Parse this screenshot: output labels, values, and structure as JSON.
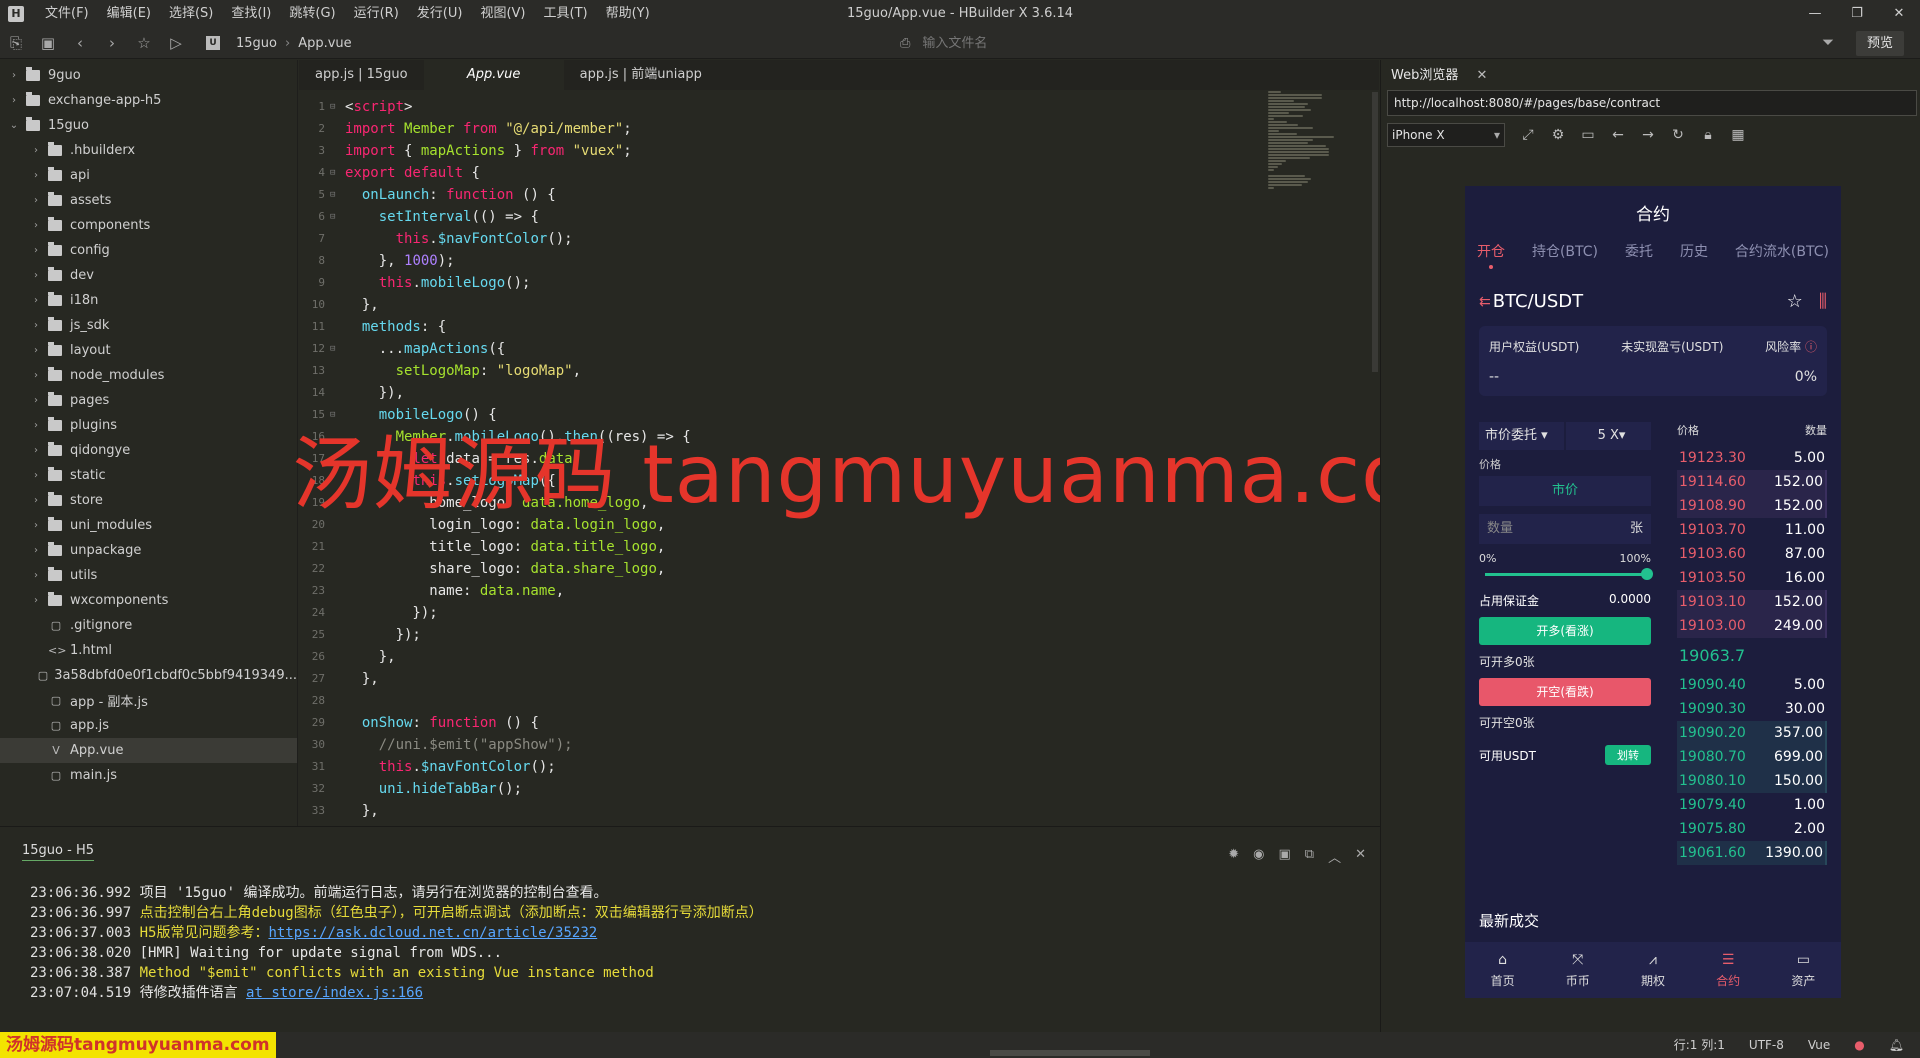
{
  "window": {
    "title": "15guo/App.vue - HBuilder X 3.6.14",
    "logo": "H",
    "menus": [
      "文件(F)",
      "编辑(E)",
      "选择(S)",
      "查找(I)",
      "跳转(G)",
      "运行(R)",
      "发行(U)",
      "视图(V)",
      "工具(T)",
      "帮助(Y)"
    ]
  },
  "toolbar": {
    "breadcrumb": [
      "15guo",
      "App.vue"
    ],
    "file_search_placeholder": "输入文件名",
    "preview_label": "预览"
  },
  "sidebar": {
    "items": [
      {
        "label": "9guo",
        "type": "folder",
        "expanded": false,
        "level": 0
      },
      {
        "label": "exchange-app-h5",
        "type": "folder",
        "expanded": false,
        "level": 0
      },
      {
        "label": "15guo",
        "type": "folder",
        "expanded": true,
        "level": 0
      },
      {
        "label": ".hbuilderx",
        "type": "folder",
        "level": 1
      },
      {
        "label": "api",
        "type": "folder",
        "level": 1
      },
      {
        "label": "assets",
        "type": "folder",
        "level": 1
      },
      {
        "label": "components",
        "type": "folder",
        "level": 1
      },
      {
        "label": "config",
        "type": "folder",
        "level": 1
      },
      {
        "label": "dev",
        "type": "folder",
        "level": 1
      },
      {
        "label": "i18n",
        "type": "folder",
        "level": 1
      },
      {
        "label": "js_sdk",
        "type": "folder",
        "level": 1
      },
      {
        "label": "layout",
        "type": "folder",
        "level": 1
      },
      {
        "label": "node_modules",
        "type": "folder",
        "level": 1
      },
      {
        "label": "pages",
        "type": "folder",
        "level": 1
      },
      {
        "label": "plugins",
        "type": "folder",
        "level": 1
      },
      {
        "label": "qidongye",
        "type": "folder",
        "level": 1
      },
      {
        "label": "static",
        "type": "folder",
        "level": 1
      },
      {
        "label": "store",
        "type": "folder",
        "level": 1
      },
      {
        "label": "uni_modules",
        "type": "folder",
        "level": 1
      },
      {
        "label": "unpackage",
        "type": "folder",
        "level": 1
      },
      {
        "label": "utils",
        "type": "folder",
        "level": 1
      },
      {
        "label": "wxcomponents",
        "type": "folder",
        "level": 1
      },
      {
        "label": ".gitignore",
        "type": "file",
        "level": 1
      },
      {
        "label": "1.html",
        "type": "html",
        "level": 1
      },
      {
        "label": "3a58dbfd0e0f1cbdf0c5bbf9419349...",
        "type": "file",
        "level": 1
      },
      {
        "label": "app - 副本.js",
        "type": "file",
        "level": 1
      },
      {
        "label": "app.js",
        "type": "file",
        "level": 1
      },
      {
        "label": "App.vue",
        "type": "vue",
        "level": 1,
        "selected": true
      },
      {
        "label": "main.js",
        "type": "file",
        "level": 1
      }
    ]
  },
  "tabs": [
    {
      "label": "app.js | 15guo",
      "active": false
    },
    {
      "label": "App.vue",
      "active": true
    },
    {
      "label": "app.js | 前端uniapp",
      "active": false
    }
  ],
  "editor": {
    "lines": [
      [
        [
          "tx",
          "<"
        ],
        [
          "kw",
          "script"
        ],
        [
          "tx",
          ">"
        ]
      ],
      [
        [
          "kw",
          "import"
        ],
        [
          "tx",
          " "
        ],
        [
          "pr",
          "Member"
        ],
        [
          "tx",
          " "
        ],
        [
          "kw",
          "from"
        ],
        [
          "tx",
          " "
        ],
        [
          "str",
          "\"@/api/member\""
        ],
        [
          "tx",
          ";"
        ]
      ],
      [
        [
          "kw",
          "import"
        ],
        [
          "tx",
          " { "
        ],
        [
          "pr",
          "mapActions"
        ],
        [
          "tx",
          " } "
        ],
        [
          "kw",
          "from"
        ],
        [
          "tx",
          " "
        ],
        [
          "str",
          "\"vuex\""
        ],
        [
          "tx",
          ";"
        ]
      ],
      [
        [
          "kw",
          "export default"
        ],
        [
          "tx",
          " {"
        ]
      ],
      [
        [
          "tx",
          "  "
        ],
        [
          "fn",
          "onLaunch"
        ],
        [
          "tx",
          ": "
        ],
        [
          "kw",
          "function"
        ],
        [
          "tx",
          " () {"
        ]
      ],
      [
        [
          "tx",
          "    "
        ],
        [
          "fn",
          "setInterval"
        ],
        [
          "tx",
          "(() => {"
        ]
      ],
      [
        [
          "tx",
          "      "
        ],
        [
          "kw",
          "this"
        ],
        [
          "tx",
          "."
        ],
        [
          "fn",
          "$navFontColor"
        ],
        [
          "tx",
          "();"
        ]
      ],
      [
        [
          "tx",
          "    }, "
        ],
        [
          "num",
          "1000"
        ],
        [
          "tx",
          ");"
        ]
      ],
      [
        [
          "tx",
          "    "
        ],
        [
          "kw",
          "this"
        ],
        [
          "tx",
          "."
        ],
        [
          "fn",
          "mobileLogo"
        ],
        [
          "tx",
          "();"
        ]
      ],
      [
        [
          "tx",
          "  },"
        ]
      ],
      [
        [
          "tx",
          "  "
        ],
        [
          "fn",
          "methods"
        ],
        [
          "tx",
          ": {"
        ]
      ],
      [
        [
          "tx",
          "    ..."
        ],
        [
          "fn",
          "mapActions"
        ],
        [
          "tx",
          "({"
        ]
      ],
      [
        [
          "tx",
          "      "
        ],
        [
          "pr",
          "setLogoMap"
        ],
        [
          "tx",
          ": "
        ],
        [
          "str",
          "\"logoMap\""
        ],
        [
          "tx",
          ","
        ]
      ],
      [
        [
          "tx",
          "    }),"
        ]
      ],
      [
        [
          "tx",
          "    "
        ],
        [
          "fn",
          "mobileLogo"
        ],
        [
          "tx",
          "() {"
        ]
      ],
      [
        [
          "tx",
          "      "
        ],
        [
          "pr",
          "Member"
        ],
        [
          "tx",
          "."
        ],
        [
          "fn",
          "mobileLogo"
        ],
        [
          "tx",
          "()."
        ],
        [
          "fn",
          "then"
        ],
        [
          "tx",
          "((res) => {"
        ]
      ],
      [
        [
          "tx",
          "        "
        ],
        [
          "kw",
          "let"
        ],
        [
          "tx",
          " data = res."
        ],
        [
          "pr",
          "data"
        ],
        [
          "tx",
          ";"
        ]
      ],
      [
        [
          "tx",
          "        "
        ],
        [
          "kw",
          "this"
        ],
        [
          "tx",
          "."
        ],
        [
          "fn",
          "setLogoMap"
        ],
        [
          "tx",
          "({"
        ]
      ],
      [
        [
          "tx",
          "          home_logo: "
        ],
        [
          "pr",
          "data.home_logo"
        ],
        [
          "tx",
          ","
        ]
      ],
      [
        [
          "tx",
          "          login_logo: "
        ],
        [
          "pr",
          "data.login_logo"
        ],
        [
          "tx",
          ","
        ]
      ],
      [
        [
          "tx",
          "          title_logo: "
        ],
        [
          "pr",
          "data.title_logo"
        ],
        [
          "tx",
          ","
        ]
      ],
      [
        [
          "tx",
          "          share_logo: "
        ],
        [
          "pr",
          "data.share_logo"
        ],
        [
          "tx",
          ","
        ]
      ],
      [
        [
          "tx",
          "          name: "
        ],
        [
          "pr",
          "data.name"
        ],
        [
          "tx",
          ","
        ]
      ],
      [
        [
          "tx",
          "        });"
        ]
      ],
      [
        [
          "tx",
          "      });"
        ]
      ],
      [
        [
          "tx",
          "    },"
        ]
      ],
      [
        [
          "tx",
          "  },"
        ]
      ],
      [
        [
          "tx",
          ""
        ]
      ],
      [
        [
          "tx",
          "  "
        ],
        [
          "fn",
          "onShow"
        ],
        [
          "tx",
          ": "
        ],
        [
          "kw",
          "function"
        ],
        [
          "tx",
          " () {"
        ]
      ],
      [
        [
          "tx",
          "    "
        ],
        [
          "cm",
          "//uni.$emit(\"appShow\");"
        ]
      ],
      [
        [
          "tx",
          "    "
        ],
        [
          "kw",
          "this"
        ],
        [
          "tx",
          "."
        ],
        [
          "fn",
          "$navFontColor"
        ],
        [
          "tx",
          "();"
        ]
      ],
      [
        [
          "tx",
          "    "
        ],
        [
          "fn",
          "uni.hideTabBar"
        ],
        [
          "tx",
          "();"
        ]
      ],
      [
        [
          "tx",
          "  },"
        ]
      ]
    ],
    "fold_lines": [
      1,
      4,
      5,
      6,
      12,
      15
    ]
  },
  "watermark_text": "汤姆源码 tangmuyuanma.com",
  "console": {
    "tab_label": "15guo - H5",
    "logs": [
      {
        "time": "23:06:36.992",
        "text": "项目 '15guo' 编译成功。前端运行日志，请另行在浏览器的控制台查看。",
        "style": "white"
      },
      {
        "time": "23:06:36.997",
        "text": "点击控制台右上角debug图标（红色虫子），可开启断点调试（添加断点：双击编辑器行号添加断点）",
        "style": "yellow"
      },
      {
        "time": "23:06:37.003",
        "text": "H5版常见问题参考：",
        "style": "yellow",
        "link": "https://ask.dcloud.net.cn/article/35232"
      },
      {
        "time": "23:06:38.020",
        "text": "[HMR] Waiting for update signal from WDS...",
        "style": "white"
      },
      {
        "time": "23:06:38.387",
        "text": "Method \"$emit\" conflicts with an existing Vue instance method",
        "style": "yellow"
      },
      {
        "time": "23:07:04.519",
        "text": "待修改插件语言  ",
        "style": "white",
        "link": "at store/index.js:166"
      }
    ]
  },
  "browser": {
    "tab_label": "Web浏览器",
    "url": "http://localhost:8080/#/pages/base/contract",
    "device": "iPhone X"
  },
  "phone": {
    "title": "合约",
    "tabs": [
      "开仓",
      "持仓(BTC)",
      "委托",
      "历史",
      "合约流水(BTC)"
    ],
    "pair": "BTC/USDT",
    "equity_labels": [
      "用户权益(USDT)",
      "未实现盈亏(USDT)",
      "风险率"
    ],
    "equity_values": [
      "--",
      "0%"
    ],
    "order_type": "市价委托",
    "leverage": "5 X",
    "price_label": "价格",
    "market_label": "市价",
    "qty_placeholder": "数量",
    "qty_unit": "张",
    "slider_min": "0%",
    "slider_max": "100%",
    "slider_value": 1.0,
    "margin_label": "占用保证金",
    "margin_value": "0.0000",
    "long_btn": "开多(看涨)",
    "long_avail": "可开多0张",
    "short_btn": "开空(看跌)",
    "short_avail": "可开空0张",
    "usdt_label": "可用USDT",
    "transfer_btn": "划转",
    "book_header": [
      "价格",
      "数量"
    ],
    "asks": [
      [
        "19123.30",
        "5.00"
      ],
      [
        "19114.60",
        "152.00"
      ],
      [
        "19108.90",
        "152.00"
      ],
      [
        "19103.70",
        "11.00"
      ],
      [
        "19103.60",
        "87.00"
      ],
      [
        "19103.50",
        "16.00"
      ],
      [
        "19103.10",
        "152.00"
      ],
      [
        "19103.00",
        "249.00"
      ]
    ],
    "mid_price": "19063.7",
    "bids": [
      [
        "19090.40",
        "5.00"
      ],
      [
        "19090.30",
        "30.00"
      ],
      [
        "19090.20",
        "357.00"
      ],
      [
        "19080.70",
        "699.00"
      ],
      [
        "19080.10",
        "150.00"
      ],
      [
        "19079.40",
        "1.00"
      ],
      [
        "19075.80",
        "2.00"
      ],
      [
        "19061.60",
        "1390.00"
      ]
    ],
    "recent_label": "最新成交",
    "nav": [
      "首页",
      "币币",
      "期权",
      "合约",
      "资产"
    ]
  },
  "status": {
    "watermark": "汤姆源码tangmuyuanma.com",
    "position": "行:1  列:1",
    "encoding": "UTF-8",
    "language": "Vue"
  }
}
